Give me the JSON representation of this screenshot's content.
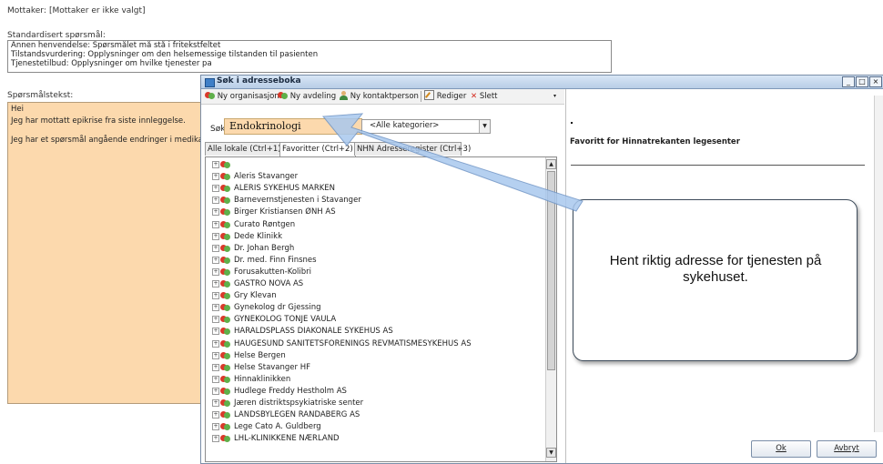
{
  "form": {
    "recipient_label": "Mottaker:",
    "recipient_value": "[Mottaker er ikke valgt]",
    "standard_question_label": "Standardisert spørsmål:",
    "standard_questions": [
      "Annen henvendelse: Spørsmålet må stå i fritekstfeltet",
      "Tilstandsvurdering: Opplysninger om den helsemessige tilstanden til pasienten",
      "Tjenestetilbud: Opplysninger om hvilke tjenester pa"
    ],
    "question_text_label": "Spørsmålstekst:",
    "question_text_lines": [
      "Hei",
      "Jeg har mottatt epikrise fra siste innleggelse.",
      "",
      "Jeg har et spørsmål angående endringer i medikasj"
    ]
  },
  "dialog": {
    "title": "Søk i adresseboka",
    "window_buttons": [
      "_",
      "□",
      "×"
    ],
    "toolbar": {
      "new_org": "Ny organisasjon",
      "new_dept": "Ny avdeling",
      "new_contact": "Ny kontaktperson",
      "edit": "Rediger",
      "delete": "Slett"
    },
    "search": {
      "label": "Søk",
      "value": "Endokrinologi",
      "category": "<Alle kategorier>"
    },
    "tabs": [
      "Alle lokale (Ctrl+1)",
      "Favoritter (Ctrl+2)",
      "NHN Adresseregister (Ctrl+3)"
    ],
    "tree_items": [
      "",
      "Aleris Stavanger",
      "ALERIS SYKEHUS MARKEN",
      "Barnevernstjenesten i Stavanger",
      "Birger Kristiansen ØNH AS",
      "Curato Røntgen",
      "Dede Klinikk",
      "Dr. Johan Bergh",
      "Dr. med. Finn Finsnes",
      "Forusakutten-Kolibri",
      "GASTRO NOVA AS",
      "Gry Klevan",
      "Gynekolog dr Gjessing",
      "GYNEKOLOG TONJE VAULA",
      "HARALDSPLASS DIAKONALE SYKEHUS AS",
      "HAUGESUND SANITETSFORENINGS REVMATISMESYKEHUS AS",
      "Helse Bergen",
      "Helse Stavanger HF",
      "Hinnaklinikken",
      "Hudlege Freddy Hestholm AS",
      "Jæren distriktspsykiatriske senter",
      "LANDSBYLEGEN RANDABERG AS",
      "Lege Cato A. Guldberg",
      "LHL-KLINIKKENE NÆRLAND"
    ],
    "favorite_title": "Favoritt for Hinnatrekanten legesenter",
    "callout_text": "Hent riktig adresse for tjenesten på sykehuset.",
    "ok_label": "Ok",
    "cancel_label": "Avbryt"
  },
  "colors": {
    "accent_peach": "#fcd9ad",
    "arrow": "#9fc0e8"
  },
  "icons": [
    "new-organization-icon",
    "new-department-icon",
    "new-contact-icon",
    "edit-icon",
    "delete-icon",
    "organization-icon"
  ]
}
